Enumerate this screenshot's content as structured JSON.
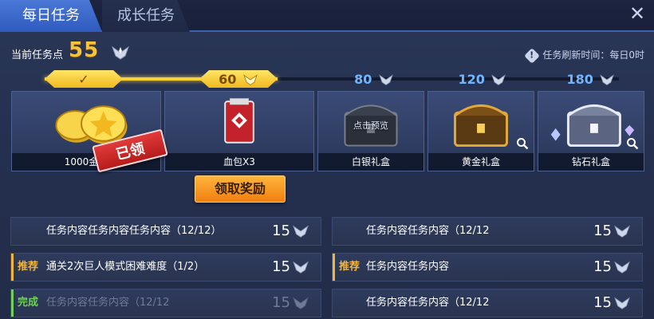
{
  "tabs": [
    {
      "label": "每日任务",
      "active": true
    },
    {
      "label": "成长任务",
      "active": false
    }
  ],
  "close_label": "✕",
  "points": {
    "label": "当前任务点",
    "value": "55"
  },
  "refresh": {
    "icon": "info-icon",
    "text": "任务刷新时间：每日0时"
  },
  "progress": {
    "current": 55,
    "max": 180
  },
  "milestones": [
    {
      "label": "✓",
      "done": true
    },
    {
      "label": "60",
      "done": true
    },
    {
      "label": "80",
      "done": false
    },
    {
      "label": "120",
      "done": false
    },
    {
      "label": "180",
      "done": false
    }
  ],
  "rewards": [
    {
      "name": "1000金币",
      "icon": "gold-coins"
    },
    {
      "name": "血包X3",
      "icon": "blood-pack"
    },
    {
      "name": "白银礼盒",
      "icon": "silver-chest",
      "overlay": "点击预览"
    },
    {
      "name": "黄金礼盒",
      "icon": "gold-chest"
    },
    {
      "name": "钻石礼盒",
      "icon": "diamond-chest"
    }
  ],
  "claimed_stamp": "已领",
  "claim_button": "领取奖励",
  "tasks": [
    {
      "tag": "",
      "tag_color": "",
      "text": "任务内容任务内容任务内容（12/12）",
      "reward": "15",
      "dim": false
    },
    {
      "tag": "",
      "tag_color": "",
      "text": "任务内容任务内容（12/12",
      "reward": "15",
      "dim": false
    },
    {
      "tag": "推荐",
      "tag_color": "#f2b53a",
      "text": "通关2次巨人模式困难难度（1/2）",
      "reward": "15",
      "dim": false
    },
    {
      "tag": "推荐",
      "tag_color": "#f2b53a",
      "text": "任务内容任务内容",
      "reward": "15",
      "dim": false
    },
    {
      "tag": "完成",
      "tag_color": "#6fd05a",
      "text": "任务内容任务内容（12/12",
      "reward": "15",
      "dim": true
    },
    {
      "tag": "",
      "tag_color": "",
      "text": "任务内容任务内容（12/12",
      "reward": "15",
      "dim": false
    }
  ]
}
